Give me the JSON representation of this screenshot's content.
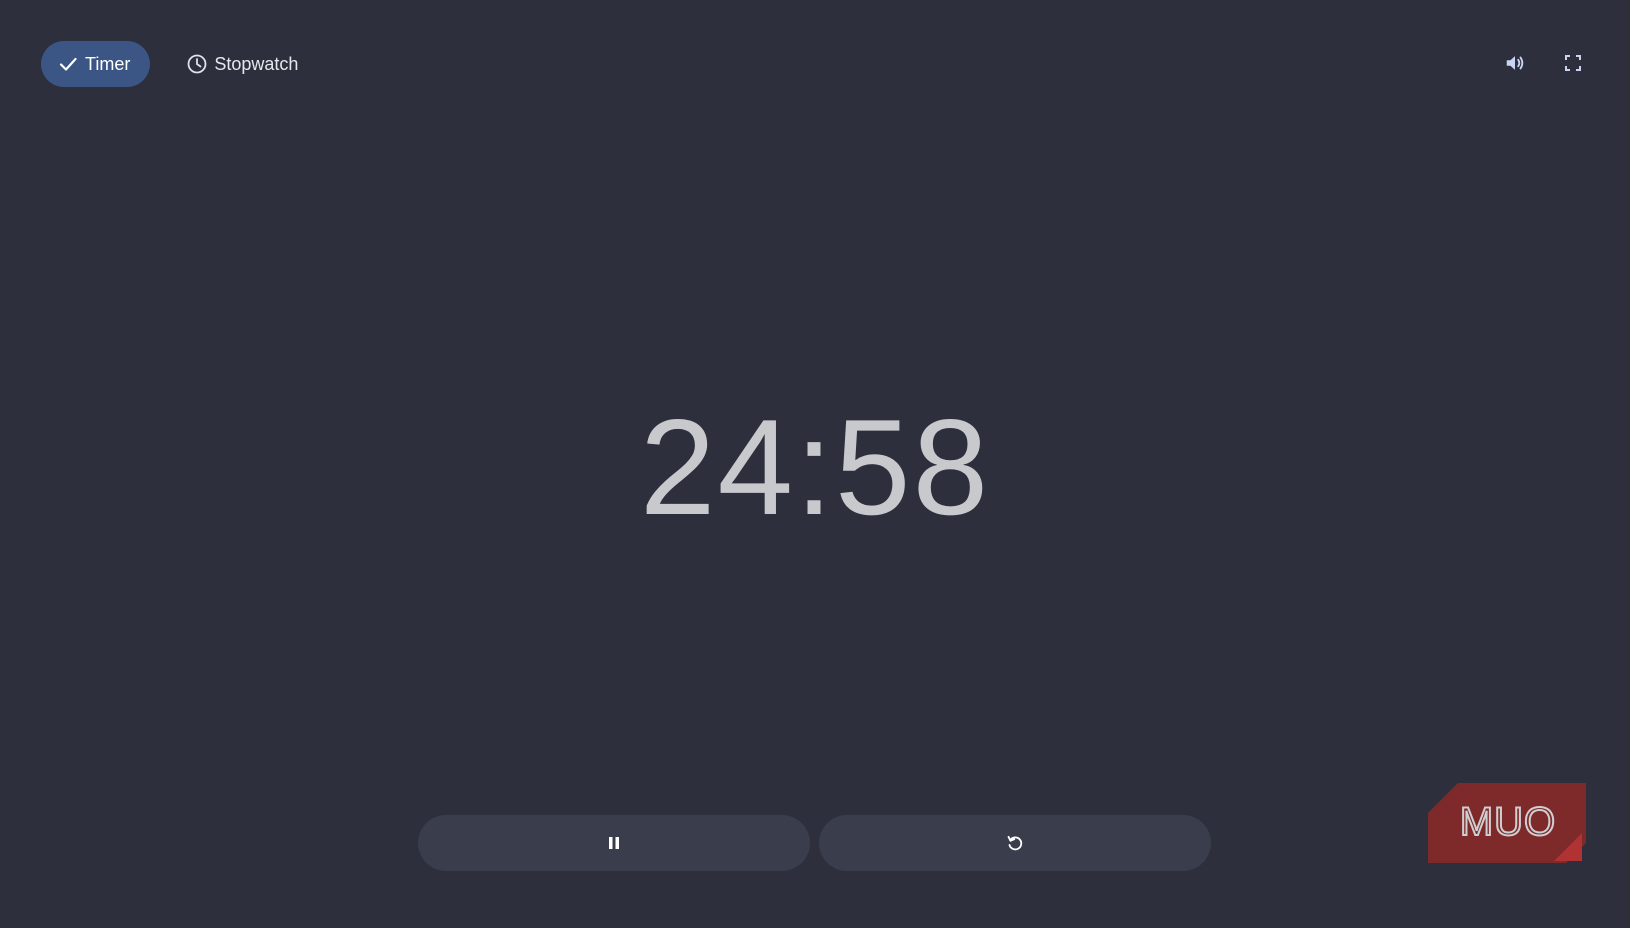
{
  "tabs": [
    {
      "label": "Timer",
      "icon": "check-icon",
      "active": true
    },
    {
      "label": "Stopwatch",
      "icon": "clock-icon",
      "active": false
    }
  ],
  "toolbar": {
    "icons": [
      "volume-icon",
      "fullscreen-icon"
    ]
  },
  "timer": {
    "display": "24:58"
  },
  "controls": {
    "pause_icon": "pause-icon",
    "reset_icon": "reset-icon"
  },
  "watermark": {
    "text": "MUO",
    "color": "#7e2a2a"
  },
  "colors": {
    "background": "#2d303c",
    "active_tab": "#3b5584",
    "button": "#3a3d4b",
    "time_text": "#c8c9cd"
  }
}
